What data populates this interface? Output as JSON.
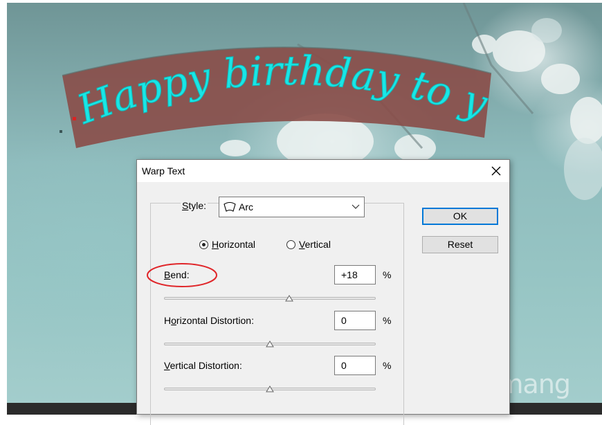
{
  "canvas": {
    "art_text": "Happy birthday to you",
    "art_text_color": "#19e6e6",
    "banner_color": "#8a4d48"
  },
  "dialog": {
    "title": "Warp Text",
    "style_label_prefix": "",
    "style_label_mnemonic": "S",
    "style_label_rest": "tyle:",
    "style_value": "Arc",
    "ok_label": "OK",
    "reset_label": "Reset",
    "orientation": {
      "horizontal_mnemonic": "H",
      "horizontal_rest": "orizontal",
      "vertical_mnemonic": "V",
      "vertical_rest": "ertical",
      "selected": "Horizontal"
    },
    "bend": {
      "mnemonic": "B",
      "rest": "end:",
      "value": "+18",
      "unit": "%",
      "level_percent": 18
    },
    "horizontal_distortion": {
      "prefix": "H",
      "mnemonic": "o",
      "rest": "rizontal Distortion:",
      "value": "0",
      "unit": "%",
      "level_percent": 0
    },
    "vertical_distortion": {
      "mnemonic": "V",
      "rest": "ertical Distortion:",
      "value": "0",
      "unit": "%",
      "level_percent": 0
    },
    "highlight_color": "#e0262a"
  },
  "watermark": {
    "text": "uantrimang"
  }
}
